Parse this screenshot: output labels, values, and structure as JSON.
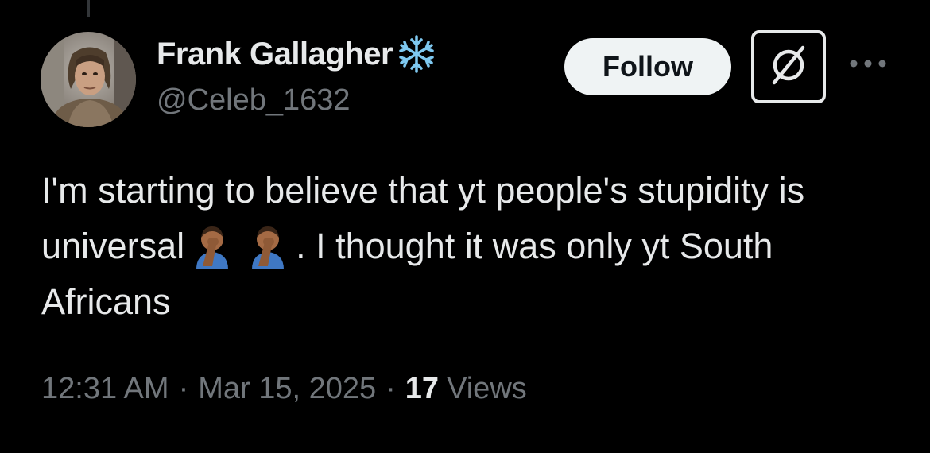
{
  "author": {
    "display_name": "Frank Gallagher",
    "badge_icon": "snowflake-icon",
    "badge_color": "#7ec8f0",
    "handle": "@Celeb_1632"
  },
  "actions": {
    "follow_label": "Follow",
    "grok_icon": "grok-icon",
    "more_icon": "more-icon"
  },
  "tweet": {
    "text_part1": "I'm starting to believe that yt people's stupidity is universal",
    "emoji_name": "person-facepalming-emoji",
    "text_part2": ". I thought it was only yt South Africans"
  },
  "meta": {
    "time": "12:31 AM",
    "separator": "·",
    "date": "Mar 15, 2025",
    "views_count": "17",
    "views_label": "Views"
  },
  "colors": {
    "background": "#000000",
    "text": "#e7e9ea",
    "secondary": "#71767b",
    "follow_bg": "#eff3f4"
  }
}
